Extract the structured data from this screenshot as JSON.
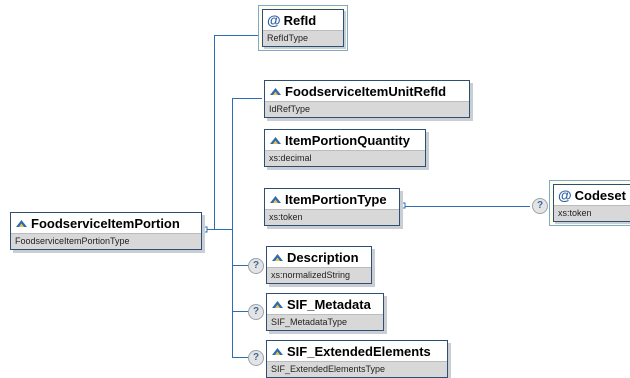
{
  "root": {
    "name": "FoodserviceItemPortion",
    "type": "FoodserviceItemPortionType"
  },
  "attributes": [
    {
      "name": "RefId",
      "type": "RefIdType"
    }
  ],
  "elements": [
    {
      "name": "FoodserviceItemUnitRefId",
      "type": "IdRefType",
      "optional": false
    },
    {
      "name": "ItemPortionQuantity",
      "type": "xs:decimal",
      "optional": false
    },
    {
      "name": "ItemPortionType",
      "type": "xs:token",
      "optional": false
    },
    {
      "name": "Description",
      "type": "xs:normalizedString",
      "optional": true
    },
    {
      "name": "SIF_Metadata",
      "type": "SIF_MetadataType",
      "optional": true
    },
    {
      "name": "SIF_ExtendedElements",
      "type": "SIF_ExtendedElementsType",
      "optional": true
    }
  ],
  "child_attributes": [
    {
      "parent": "ItemPortionType",
      "name": "Codeset",
      "type": "xs:token",
      "optional": true
    }
  ],
  "symbols": {
    "attribute": "@",
    "optional": "?"
  },
  "colors": {
    "connector": "#2e6db4",
    "node_border": "#2e4f73",
    "type_band": "#d8d8d8",
    "attribute_frame": "#fdfde8",
    "icon": "#2b6cb0"
  }
}
